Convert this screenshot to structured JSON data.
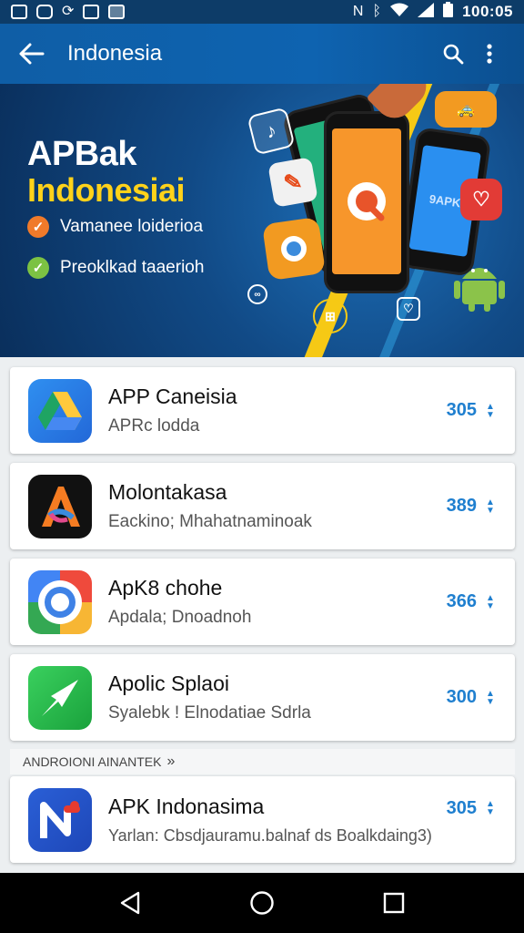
{
  "status_bar": {
    "time": "100:05"
  },
  "app_bar": {
    "title": "Indonesia"
  },
  "hero": {
    "title_line1": "APBak",
    "title_line2": "Indonesiai",
    "features": [
      {
        "text": "Vamanee loiderioa",
        "badge_color": "#f07a2a"
      },
      {
        "text": "Preoklkad taaerioh",
        "badge_color": "#7cc243"
      }
    ],
    "phone_label": "9APK"
  },
  "apps": [
    {
      "name": "APP Caneisia",
      "subtitle": "APRc lodda",
      "count": "305"
    },
    {
      "name": "Molontakasa",
      "subtitle": "Eackino; Mhahatnaminoak",
      "count": "389"
    },
    {
      "name": "ApK8 chohe",
      "subtitle": "Apdala; Dnoadnoh",
      "count": "366"
    },
    {
      "name": "Apolic Splaoi",
      "subtitle": "Syalebk ! Elnodatiae Sdrla",
      "count": "300"
    }
  ],
  "section": {
    "title": "ANDROIONI AINANTEK",
    "chevron": "»"
  },
  "featured_app": {
    "name": "APK Indonasima",
    "subtitle": "Yarlan: Cbsdjauramu.balnaf ds Boalkdaing3)",
    "count": "305"
  },
  "colors": {
    "app_bar": "#0e63b0",
    "accent_yellow": "#ffd21a",
    "count_blue": "#1f7fcf"
  }
}
